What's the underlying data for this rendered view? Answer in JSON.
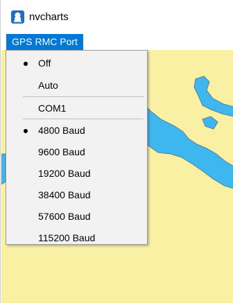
{
  "window": {
    "title": "nvcharts",
    "icon": "nvcharts-app-icon"
  },
  "menubar": {
    "active_menu": "GPS RMC Port"
  },
  "dropdown": {
    "items": [
      {
        "label": "Off",
        "checked": true
      },
      {
        "label": "Auto",
        "checked": false
      },
      {
        "label": "COM1",
        "checked": false
      },
      {
        "label": "4800 Baud",
        "checked": true
      },
      {
        "label": "9600 Baud",
        "checked": false
      },
      {
        "label": "19200 Baud",
        "checked": false
      },
      {
        "label": "38400 Baud",
        "checked": false
      },
      {
        "label": "57600 Baud",
        "checked": false
      },
      {
        "label": "115200 Baud",
        "checked": false
      }
    ]
  },
  "colors": {
    "menu_highlight": "#0078d7",
    "land": "#faf0a4",
    "water": "#3eb6ee"
  }
}
